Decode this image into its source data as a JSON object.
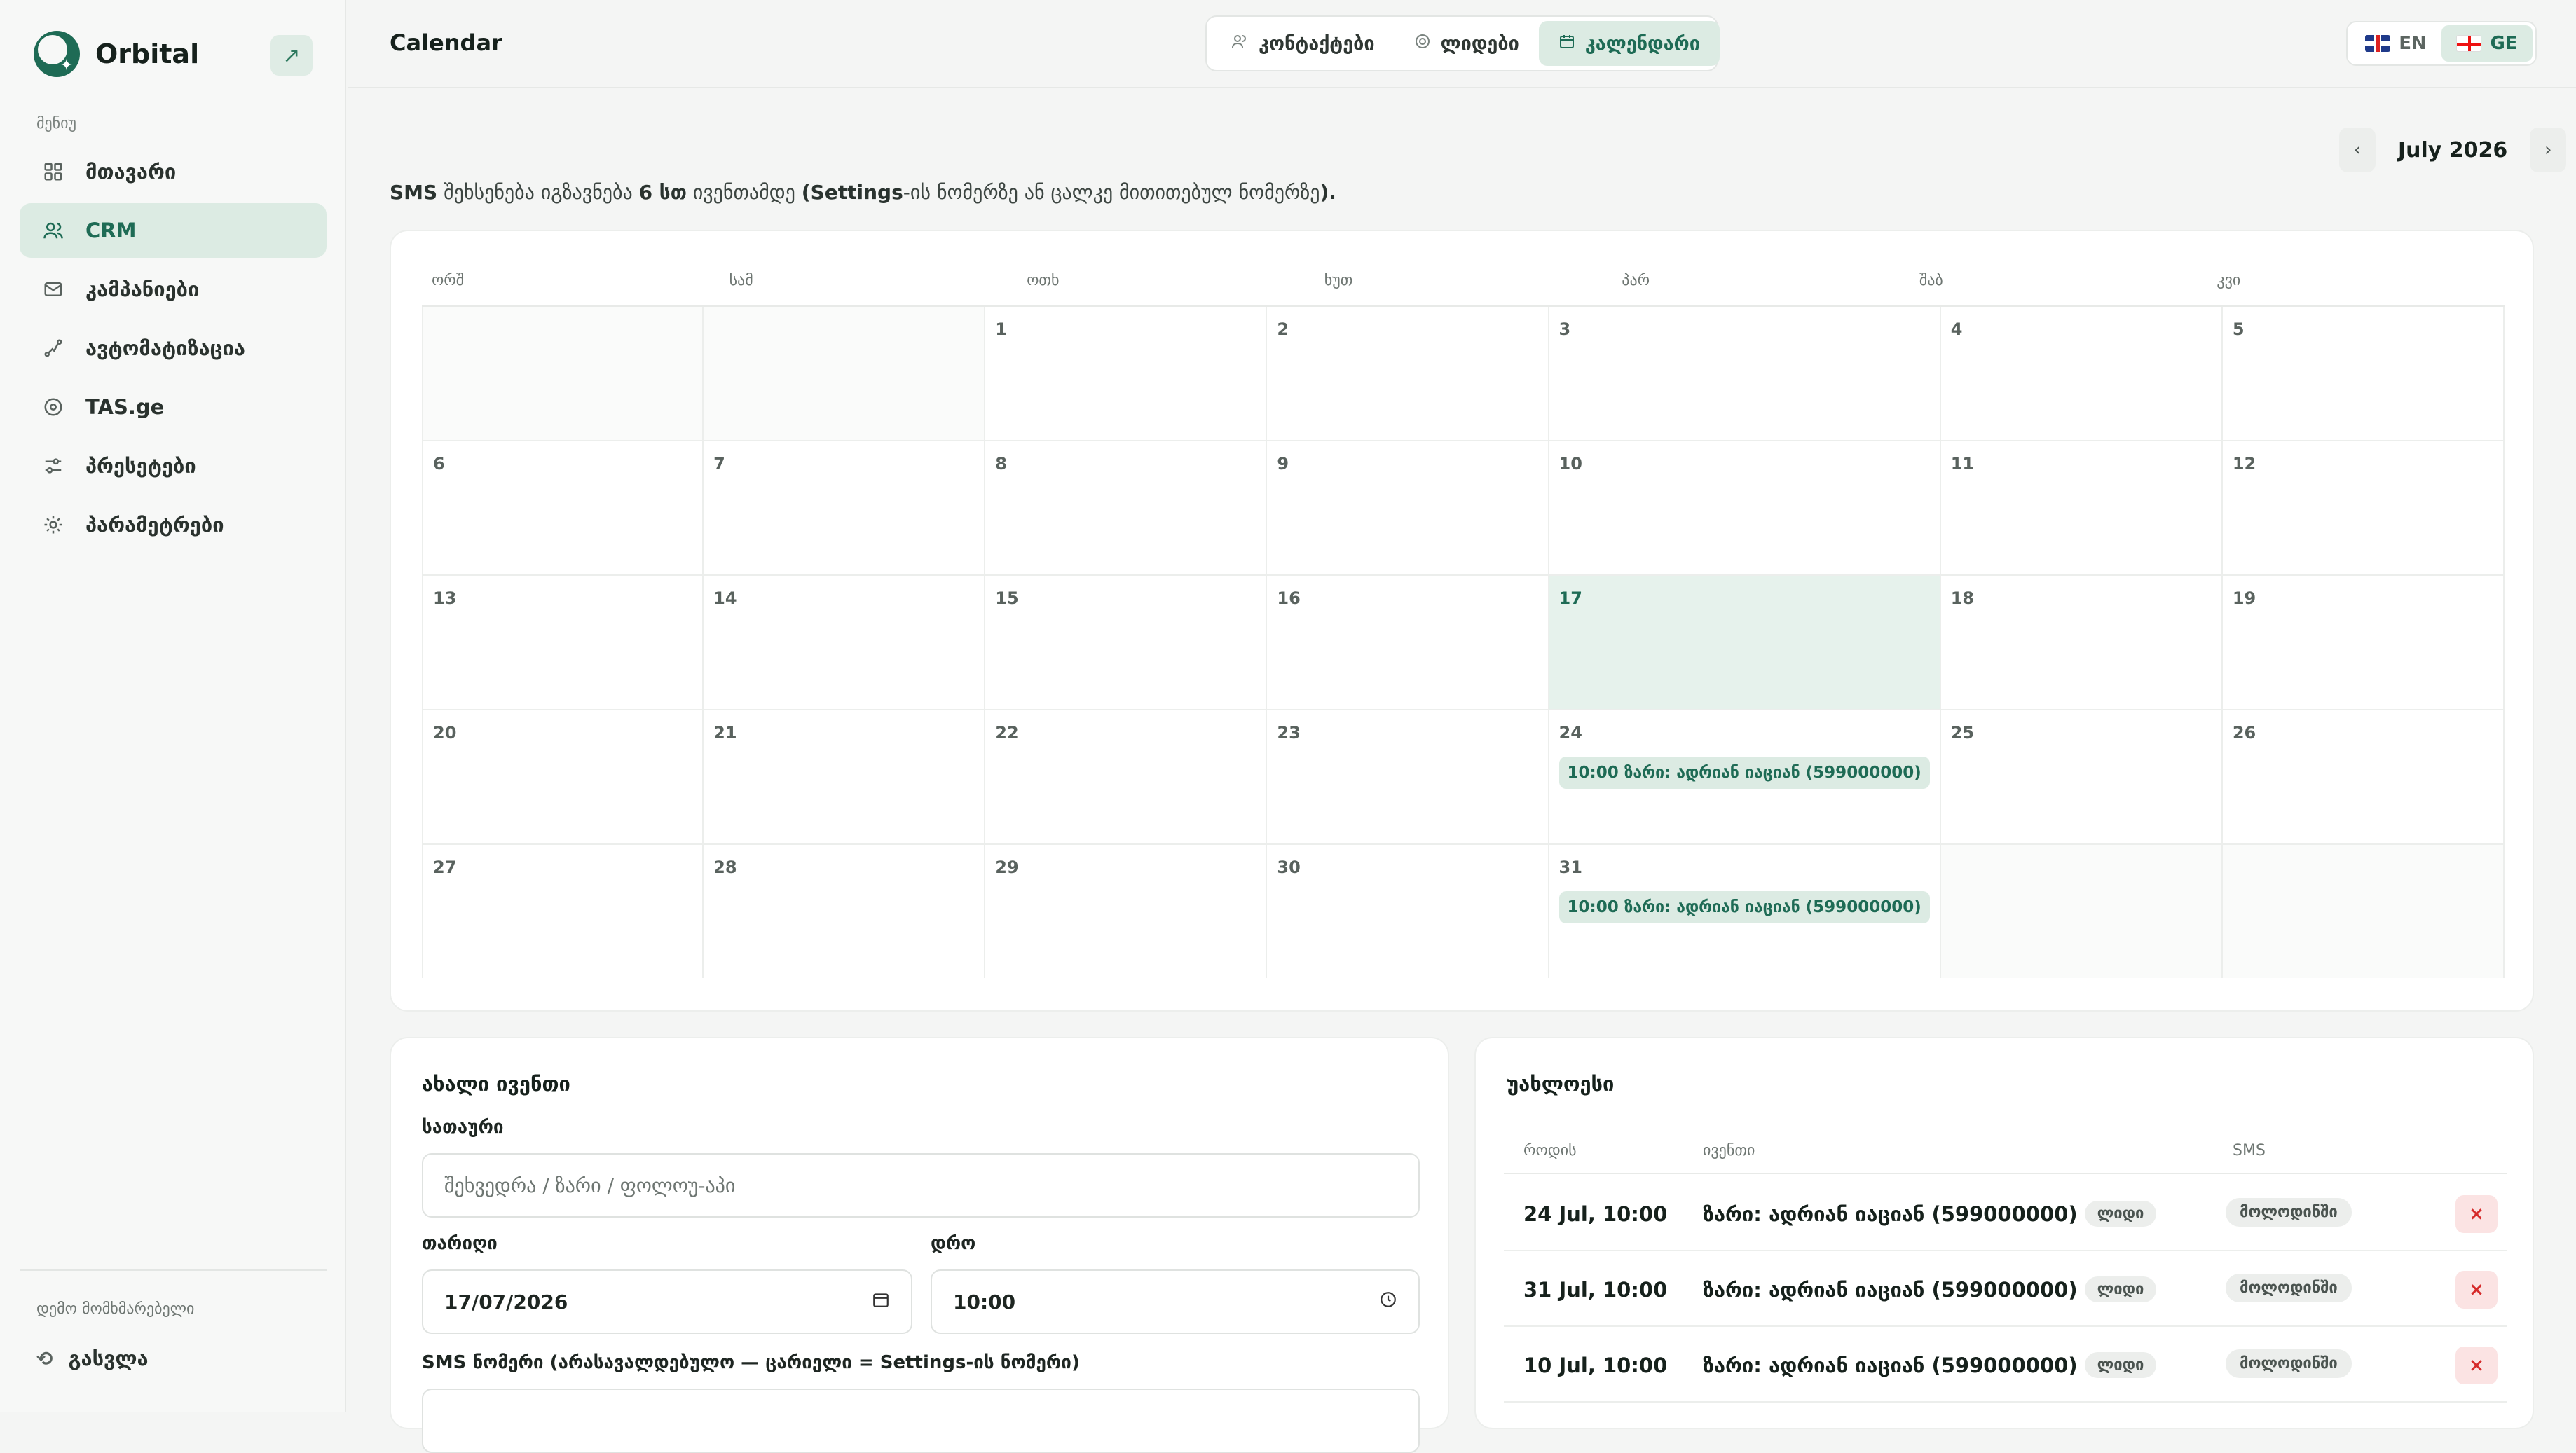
{
  "brand": {
    "name": "Orbital"
  },
  "sidebar": {
    "menu_title": "მენიუ",
    "items": [
      {
        "label": "მთავარი",
        "icon": "grid-icon"
      },
      {
        "label": "CRM",
        "icon": "users-icon",
        "active": true
      },
      {
        "label": "კამპანიები",
        "icon": "mail-icon"
      },
      {
        "label": "ავტომატიზაცია",
        "icon": "automation-icon"
      },
      {
        "label": "TAS.ge",
        "icon": "target-icon"
      },
      {
        "label": "პრესეტები",
        "icon": "sliders-icon"
      },
      {
        "label": "პარამეტრები",
        "icon": "gear-icon"
      }
    ],
    "demo_user": "დემო მომხმარებელი",
    "logout": "გასვლა"
  },
  "header": {
    "title": "Calendar",
    "tabs": [
      {
        "label": "კონტაქტები",
        "icon": "users-icon"
      },
      {
        "label": "ლიდები",
        "icon": "target-icon"
      },
      {
        "label": "კალენდარი",
        "icon": "calendar-icon",
        "active": true
      }
    ],
    "lang": {
      "en": "EN",
      "ge": "GE",
      "active": "GE"
    }
  },
  "calendar": {
    "month_label": "July 2026",
    "prev": "‹",
    "next": "›",
    "sms_note": {
      "p1": "SMS",
      "p2": " შეხსენება იგზავნება ",
      "p3": "6 სთ",
      "p4": " ივენთამდე ",
      "p5": "(Settings",
      "p6": "-ის ნომერზე ან ცალკე მითითებულ ნომერზე",
      "p7": ")."
    },
    "weekdays": [
      "ორშ",
      "სამ",
      "ოთხ",
      "ხუთ",
      "პარ",
      "შაბ",
      "კვი"
    ],
    "today": 17,
    "cells": [
      "",
      "",
      "1",
      "2",
      "3",
      "4",
      "5",
      "6",
      "7",
      "8",
      "9",
      "10",
      "11",
      "12",
      "13",
      "14",
      "15",
      "16",
      "17",
      "18",
      "19",
      "20",
      "21",
      "22",
      "23",
      "24",
      "25",
      "26",
      "27",
      "28",
      "29",
      "30",
      "31",
      "",
      ""
    ],
    "events": {
      "24": "10:00 ზარი: ადრიან იაციან (599000000)",
      "31": "10:00 ზარი: ადრიან იაციან (599000000)"
    }
  },
  "new_event": {
    "title": "ახალი ივენთი",
    "title_label": "სათაური",
    "title_placeholder": "შეხვედრა / ზარი / ფოლოუ-აპი",
    "date_label": "თარიღი",
    "date_value": "17/07/2026",
    "time_label": "დრო",
    "time_value": "10:00",
    "sms_label": "SMS ნომერი (არასავალდებულო — ცარიელი = Settings-ის ნომერი)"
  },
  "upcoming": {
    "title": "უახლოესი",
    "columns": {
      "when": "როდის",
      "event": "ივენთი",
      "sms": "SMS"
    },
    "rows": [
      {
        "when": "24 Jul, 10:00",
        "event": "ზარი: ადრიან იაციან (599000000)",
        "tag": "ლიდი",
        "sms": "მოლოდინში"
      },
      {
        "when": "31 Jul, 10:00",
        "event": "ზარი: ადრიან იაციან (599000000)",
        "tag": "ლიდი",
        "sms": "მოლოდინში"
      },
      {
        "when": "10 Jul, 10:00",
        "event": "ზარი: ადრიან იაციან (599000000)",
        "tag": "ლიდი",
        "sms": "მოლოდინში"
      }
    ],
    "delete_symbol": "×"
  }
}
